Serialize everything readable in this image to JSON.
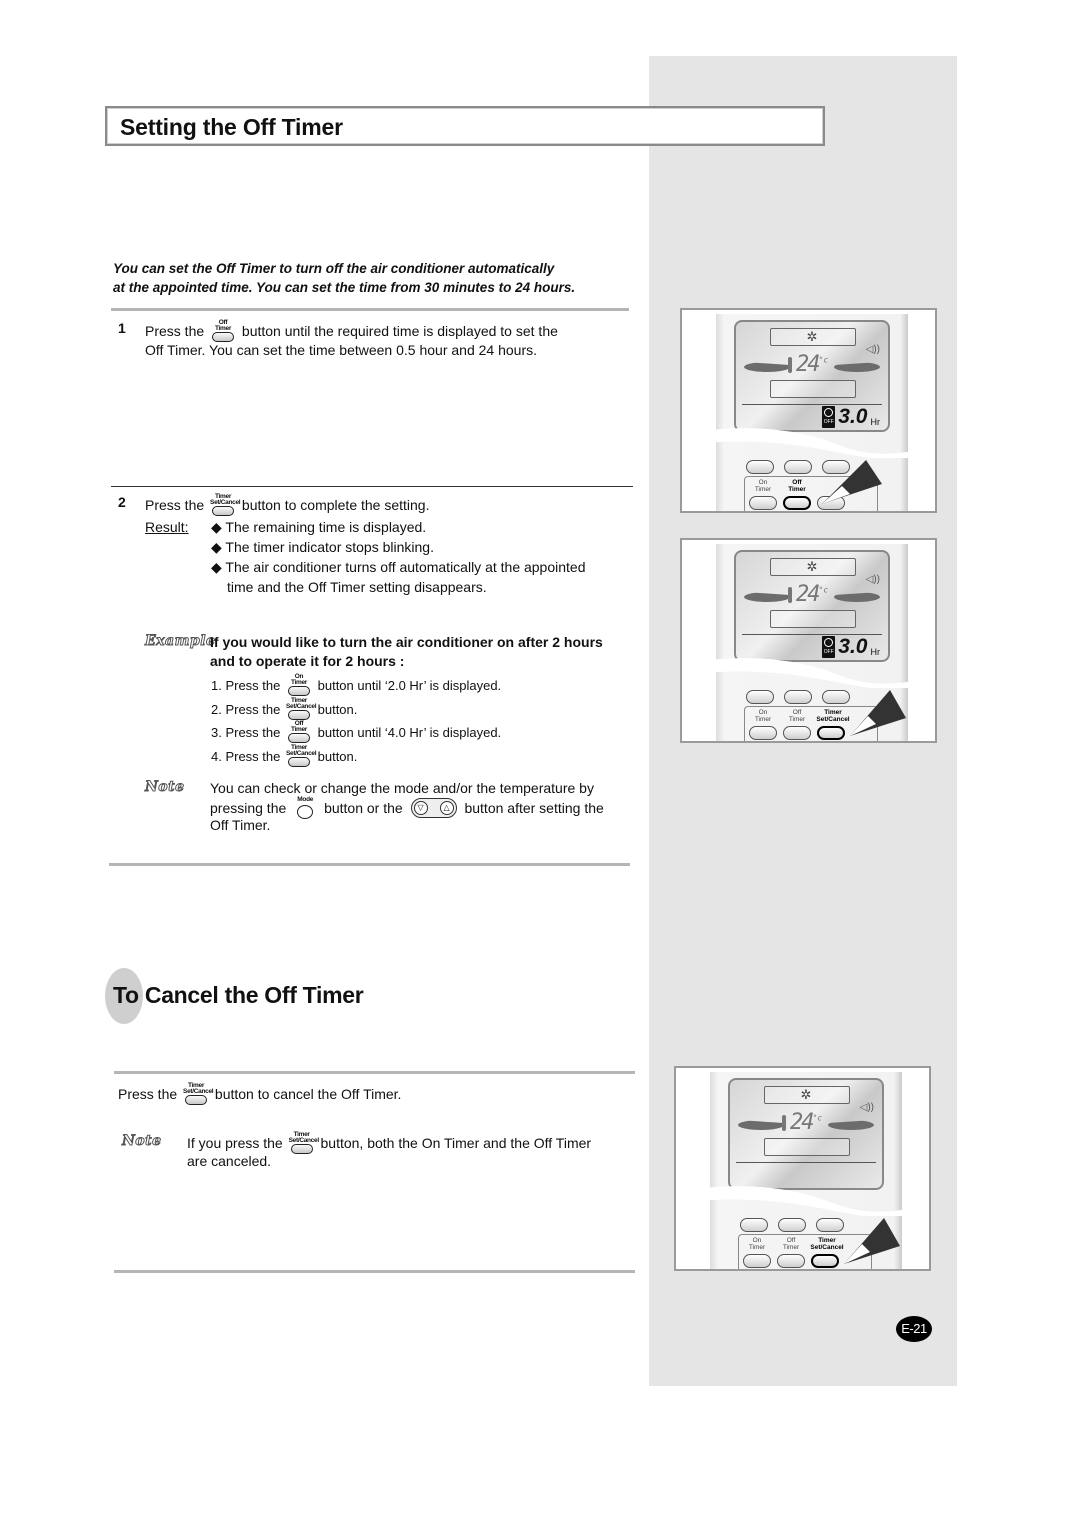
{
  "page": {
    "title": "Setting the Off Timer",
    "intro": [
      "You can set the Off Timer to turn off the air conditioner automatically",
      "at the appointed time. You can set the time from 30 minutes to 24 hours."
    ],
    "page_number": "E-21"
  },
  "buttons": {
    "off_timer": [
      "Off",
      "Timer"
    ],
    "on_timer": [
      "On",
      "Timer"
    ],
    "timer_set_cancel": [
      "Timer",
      "Set/Cancel"
    ],
    "mode": "Mode"
  },
  "step1": {
    "number": "1",
    "line1_pre": "Press the",
    "line1_post": "button until the required time is displayed to set the",
    "line2": "Off Timer. You can set the time between 0.5 hour and 24 hours."
  },
  "step2": {
    "number": "2",
    "line1_pre": "Press the",
    "line1_post": "button to complete the setting.",
    "result_label": "Result:",
    "results": [
      "The remaining time is displayed.",
      "The timer indicator stops blinking.",
      "The air conditioner turns off automatically at the appointed",
      "time and the Off Timer setting disappears."
    ],
    "bullet": "◆"
  },
  "example": {
    "label": "Example",
    "heading": [
      "If you would like to turn the air conditioner on after 2 hours",
      "and to operate it for 2 hours :"
    ],
    "steps": [
      {
        "pre": "1. Press the",
        "post": "button until ‘2.0 Hr’ is displayed."
      },
      {
        "pre": "2. Press the",
        "post": "button."
      },
      {
        "pre": "3. Press the",
        "post": "button until ‘4.0 Hr’ is displayed."
      },
      {
        "pre": "4. Press the",
        "post": "button."
      }
    ]
  },
  "note1": {
    "label": "Note",
    "line1": "You can check or change the mode and/or the temperature by",
    "line2_pre": "pressing the",
    "line2_mid": "button or the",
    "line2_post": "button after setting the",
    "line3": "Off Timer."
  },
  "cancel": {
    "heading": "To Cancel the Off Timer",
    "line_pre": "Press the",
    "line_post": "button to cancel the Off Timer.",
    "note_label": "Note",
    "note_pre": "If you press the",
    "note_post": "button,  both the On Timer and the Off Timer",
    "note_line2": "are canceled."
  },
  "remote_display": {
    "temperature": "24",
    "temp_unit": "°c",
    "timer_badge": "OFF",
    "timer_value": "3.0",
    "timer_unit": "Hr",
    "mode_icon": "✲",
    "speaker_icon": "◁))",
    "labels": {
      "on_timer": [
        "On",
        "Timer"
      ],
      "off_timer": [
        "Off",
        "Timer"
      ],
      "timer_set_cancel": [
        "Timer",
        "Set/Cancel"
      ]
    }
  },
  "colors": {
    "sidebar_bg": "#e5e5e5",
    "rule": "#b5b5b5",
    "badge_bg": "#000000"
  }
}
